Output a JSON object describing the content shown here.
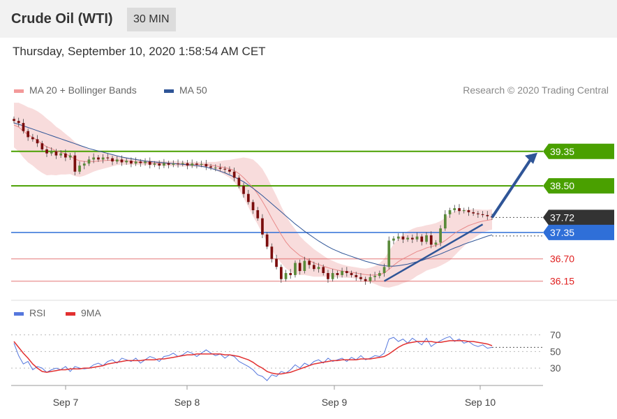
{
  "header": {
    "title": "Crude Oil (WTI)",
    "timeframe": "30 MIN"
  },
  "timestamp": "Thursday, September 10, 2020 1:58:54 AM CET",
  "legend": {
    "ma20_bb": "MA 20 + Bollinger Bands",
    "ma50": "MA 50",
    "credit": "Research © 2020 Trading Central"
  },
  "rsi_legend": {
    "rsi": "RSI",
    "ma9": "9MA"
  },
  "colors": {
    "bb": "#f3c0c0",
    "ma20": "#e88a8a",
    "ma50": "#2f5597",
    "price": "#7a0d0d",
    "resistance": "#4aa000",
    "support_blue": "#2f6fd8",
    "support_red": "#e06060",
    "current": "#333333",
    "rsi": "#5577dd",
    "rsi_ma": "#e23030"
  },
  "chart_data": [
    {
      "type": "candlestick",
      "title": "Crude Oil (WTI)",
      "interval": "30 MIN",
      "x_ticks": [
        "Sep 7",
        "Sep 8",
        "Sep 9",
        "Sep 10"
      ],
      "ylim": [
        35.85,
        40.5
      ],
      "levels": [
        {
          "value": 39.35,
          "label": "39.35",
          "kind": "resistance"
        },
        {
          "value": 38.5,
          "label": "38.50",
          "kind": "resistance"
        },
        {
          "value": 37.72,
          "label": "37.72",
          "kind": "current"
        },
        {
          "value": 37.35,
          "label": "37.35",
          "kind": "support-blue"
        },
        {
          "value": 36.7,
          "label": "36.70",
          "kind": "support"
        },
        {
          "value": 36.15,
          "label": "36.15",
          "kind": "support"
        }
      ],
      "close": [
        40.1,
        40.05,
        39.85,
        39.7,
        39.65,
        39.55,
        39.4,
        39.3,
        39.35,
        39.25,
        39.3,
        39.2,
        39.25,
        38.85,
        39.0,
        39.05,
        39.15,
        39.2,
        39.15,
        39.2,
        39.18,
        39.1,
        39.15,
        39.08,
        39.12,
        39.05,
        39.1,
        39.06,
        39.1,
        39.02,
        39.05,
        39.0,
        39.06,
        39.02,
        39.05,
        39.04,
        39.06,
        39.0,
        39.05,
        39.02,
        39.04,
        38.98,
        38.95,
        38.95,
        38.92,
        38.9,
        38.85,
        38.7,
        38.5,
        38.3,
        38.1,
        37.9,
        37.7,
        37.3,
        37.0,
        36.7,
        36.5,
        36.2,
        36.35,
        36.3,
        36.6,
        36.4,
        36.65,
        36.55,
        36.45,
        36.5,
        36.35,
        36.2,
        36.35,
        36.3,
        36.4,
        36.35,
        36.3,
        36.25,
        36.2,
        36.15,
        36.25,
        36.28,
        36.35,
        36.5,
        37.15,
        37.2,
        37.25,
        37.18,
        37.22,
        37.18,
        37.25,
        37.12,
        37.28,
        37.05,
        37.1,
        37.45,
        37.8,
        37.9,
        37.95,
        37.88,
        37.9,
        37.85,
        37.82,
        37.8,
        37.78,
        37.75,
        37.72
      ],
      "ma20": [
        40.0,
        39.95,
        39.85,
        39.76,
        39.7,
        39.62,
        39.54,
        39.46,
        39.42,
        39.36,
        39.33,
        39.28,
        39.24,
        39.16,
        39.12,
        39.1,
        39.1,
        39.1,
        39.11,
        39.12,
        39.13,
        39.13,
        39.13,
        39.12,
        39.11,
        39.1,
        39.09,
        39.08,
        39.07,
        39.07,
        39.06,
        39.06,
        39.05,
        39.05,
        39.05,
        39.04,
        39.04,
        39.03,
        39.03,
        39.03,
        39.02,
        39.02,
        39.01,
        38.99,
        38.97,
        38.95,
        38.92,
        38.88,
        38.8,
        38.7,
        38.58,
        38.45,
        38.3,
        38.12,
        37.92,
        37.7,
        37.5,
        37.3,
        37.12,
        36.98,
        36.88,
        36.78,
        36.72,
        36.66,
        36.6,
        36.56,
        36.52,
        36.48,
        36.45,
        36.42,
        36.4,
        36.38,
        36.37,
        36.35,
        36.33,
        36.31,
        36.3,
        36.3,
        36.31,
        36.35,
        36.44,
        36.54,
        36.63,
        36.7,
        36.76,
        36.82,
        36.88,
        36.92,
        36.97,
        37.0,
        37.03,
        37.08,
        37.15,
        37.24,
        37.33,
        37.4,
        37.46,
        37.52,
        37.56,
        37.6,
        37.63,
        37.65,
        37.67
      ],
      "ma50": [
        40.05,
        40.02,
        39.98,
        39.94,
        39.9,
        39.86,
        39.82,
        39.78,
        39.74,
        39.7,
        39.66,
        39.62,
        39.58,
        39.54,
        39.5,
        39.46,
        39.42,
        39.39,
        39.36,
        39.33,
        39.3,
        39.27,
        39.24,
        39.21,
        39.19,
        39.17,
        39.15,
        39.13,
        39.11,
        39.1,
        39.09,
        39.08,
        39.07,
        39.06,
        39.05,
        39.04,
        39.03,
        39.02,
        39.01,
        39.0,
        38.98,
        38.96,
        38.93,
        38.9,
        38.86,
        38.82,
        38.77,
        38.72,
        38.66,
        38.6,
        38.52,
        38.44,
        38.35,
        38.26,
        38.16,
        38.06,
        37.96,
        37.86,
        37.76,
        37.66,
        37.56,
        37.47,
        37.38,
        37.3,
        37.22,
        37.14,
        37.07,
        37.0,
        36.94,
        36.89,
        36.84,
        36.8,
        36.76,
        36.72,
        36.68,
        36.64,
        36.61,
        36.58,
        36.55,
        36.53,
        36.52,
        36.52,
        36.53,
        36.55,
        36.57,
        36.6,
        36.63,
        36.66,
        36.7,
        36.74,
        36.78,
        36.82,
        36.87,
        36.92,
        36.97,
        37.01,
        37.06,
        37.1,
        37.14,
        37.18,
        37.22,
        37.26,
        37.29
      ],
      "bb_width": [
        0.55,
        0.6,
        0.65,
        0.68,
        0.7,
        0.72,
        0.72,
        0.7,
        0.65,
        0.6,
        0.55,
        0.5,
        0.45,
        0.42,
        0.4,
        0.35,
        0.3,
        0.25,
        0.22,
        0.2,
        0.18,
        0.15,
        0.12,
        0.1,
        0.09,
        0.08,
        0.07,
        0.07,
        0.06,
        0.06,
        0.06,
        0.06,
        0.06,
        0.06,
        0.06,
        0.06,
        0.06,
        0.06,
        0.06,
        0.06,
        0.06,
        0.06,
        0.08,
        0.1,
        0.14,
        0.18,
        0.22,
        0.28,
        0.38,
        0.5,
        0.6,
        0.7,
        0.75,
        0.8,
        0.8,
        0.78,
        0.75,
        0.7,
        0.65,
        0.6,
        0.55,
        0.48,
        0.42,
        0.38,
        0.34,
        0.3,
        0.26,
        0.22,
        0.2,
        0.18,
        0.16,
        0.15,
        0.14,
        0.14,
        0.14,
        0.15,
        0.18,
        0.22,
        0.28,
        0.35,
        0.45,
        0.52,
        0.58,
        0.6,
        0.62,
        0.62,
        0.6,
        0.58,
        0.56,
        0.55,
        0.55,
        0.55,
        0.56,
        0.58,
        0.55,
        0.5,
        0.45,
        0.4,
        0.36,
        0.32,
        0.28,
        0.26,
        0.25
      ],
      "arrow": {
        "from": [
          102,
          37.72
        ],
        "to": [
          118,
          39.35
        ]
      },
      "trendline": {
        "from": [
          79,
          36.15
        ],
        "to": [
          100,
          37.55
        ]
      }
    },
    {
      "type": "line",
      "title": "RSI",
      "ylim": [
        15,
        78
      ],
      "y_ticks": [
        30,
        50,
        70
      ],
      "series": [
        {
          "name": "RSI",
          "values": [
            60,
            45,
            35,
            38,
            28,
            32,
            30,
            25,
            28,
            30,
            28,
            32,
            26,
            32,
            30,
            29,
            30,
            34,
            36,
            33,
            38,
            40,
            36,
            42,
            40,
            38,
            42,
            36,
            40,
            44,
            42,
            38,
            44,
            45,
            48,
            44,
            46,
            50,
            48,
            44,
            48,
            52,
            48,
            45,
            47,
            42,
            46,
            44,
            38,
            35,
            32,
            28,
            22,
            20,
            15,
            22,
            20,
            26,
            24,
            28,
            34,
            30,
            36,
            33,
            38,
            40,
            36,
            42,
            38,
            40,
            42,
            38,
            43,
            40,
            45,
            40,
            42,
            45,
            44,
            48,
            65,
            67,
            62,
            65,
            60,
            66,
            62,
            58,
            66,
            56,
            60,
            63,
            66,
            68,
            62,
            65,
            60,
            62,
            58,
            56,
            58,
            54,
            55
          ]
        },
        {
          "name": "9MA",
          "values": [
            62,
            55,
            48,
            42,
            35,
            30,
            26,
            25,
            26,
            27,
            28,
            28,
            29,
            29,
            29,
            30,
            30,
            31,
            32,
            33,
            35,
            36,
            37,
            38,
            39,
            39,
            39,
            39,
            40,
            40,
            40,
            41,
            41,
            42,
            43,
            44,
            45,
            46,
            46,
            47,
            47,
            47,
            47,
            47,
            47,
            46,
            46,
            45,
            44,
            42,
            40,
            37,
            33,
            30,
            26,
            24,
            23,
            23,
            24,
            25,
            27,
            29,
            31,
            33,
            35,
            36,
            37,
            38,
            39,
            39,
            40,
            40,
            40,
            40,
            41,
            41,
            41,
            42,
            43,
            44,
            47,
            51,
            55,
            58,
            60,
            61,
            62,
            62,
            62,
            62,
            61,
            61,
            62,
            63,
            63,
            63,
            63,
            62,
            62,
            61,
            60,
            59,
            57
          ]
        }
      ]
    }
  ]
}
